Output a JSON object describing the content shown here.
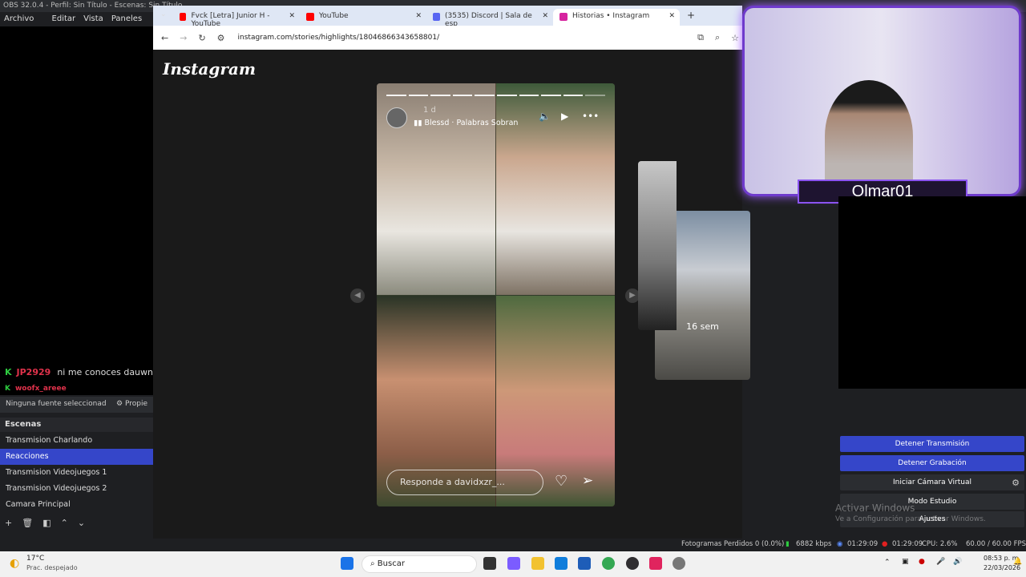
{
  "obs": {
    "title": "OBS 32.0.4 - Perfil: Sin Título - Escenas: Sin Título",
    "menu": [
      "Archivo (F)",
      "Editar",
      "Vista",
      "Paneles (D)"
    ],
    "chat": [
      {
        "user": "JP2929",
        "message": "ni me conoces dauwne"
      },
      {
        "user": "woofx_areee",
        "message": ""
      }
    ],
    "no_source": "Ninguna fuente seleccionad",
    "properties": "Propie",
    "scenes_title": "Escenas",
    "scenes": [
      "Transmision Charlando",
      "Reacciones",
      "Transmision Videojuegos 1",
      "Transmision Videojuegos 2",
      "Camara Principal"
    ],
    "active_scene": "Reacciones",
    "controls": {
      "stop_stream": "Detener Transmisión",
      "stop_record": "Detener Grabación",
      "virtual_cam": "Iniciar Cámara Virtual",
      "studio_mode": "Modo Estudio",
      "settings": "Ajustes"
    },
    "watermark": {
      "line1": "Activar Windows",
      "line2": "Ve a Configuración para activar Windows."
    },
    "status": {
      "dropped": "Fotogramas Perdidos 0 (0.0%)",
      "kbps": "6882 kbps",
      "stream_time": "01:29:09",
      "rec_time": "01:29:09",
      "cpu": "CPU: 2.6%",
      "fps": "60.00 / 60.00 FPS"
    }
  },
  "browser": {
    "tabs": [
      {
        "label": "Fvck [Letra] Junior H - YouTube",
        "color": "#ff0000"
      },
      {
        "label": "YouTube",
        "color": "#ff0000"
      },
      {
        "label": "(3535) Discord | Sala de esp",
        "color": "#5865f2"
      },
      {
        "label": "Historias • Instagram",
        "color": "#d6249f"
      }
    ],
    "url": "instagram.com/stories/highlights/18046866343658801/",
    "ig_logo": "Instagram",
    "story": {
      "time": "1 d",
      "music": "Blessd · Palabras Sobran",
      "reply_placeholder": "Responde a davidxzr_...",
      "segments": 10
    },
    "next_thumb_label": "16 sem"
  },
  "cam": {
    "name": "Olmar01"
  },
  "taskbar": {
    "weather_temp": "17°C",
    "weather_desc": "Prac. despejado",
    "search": "Buscar",
    "time": "08:53 p. m.",
    "date": "22/03/2026"
  }
}
